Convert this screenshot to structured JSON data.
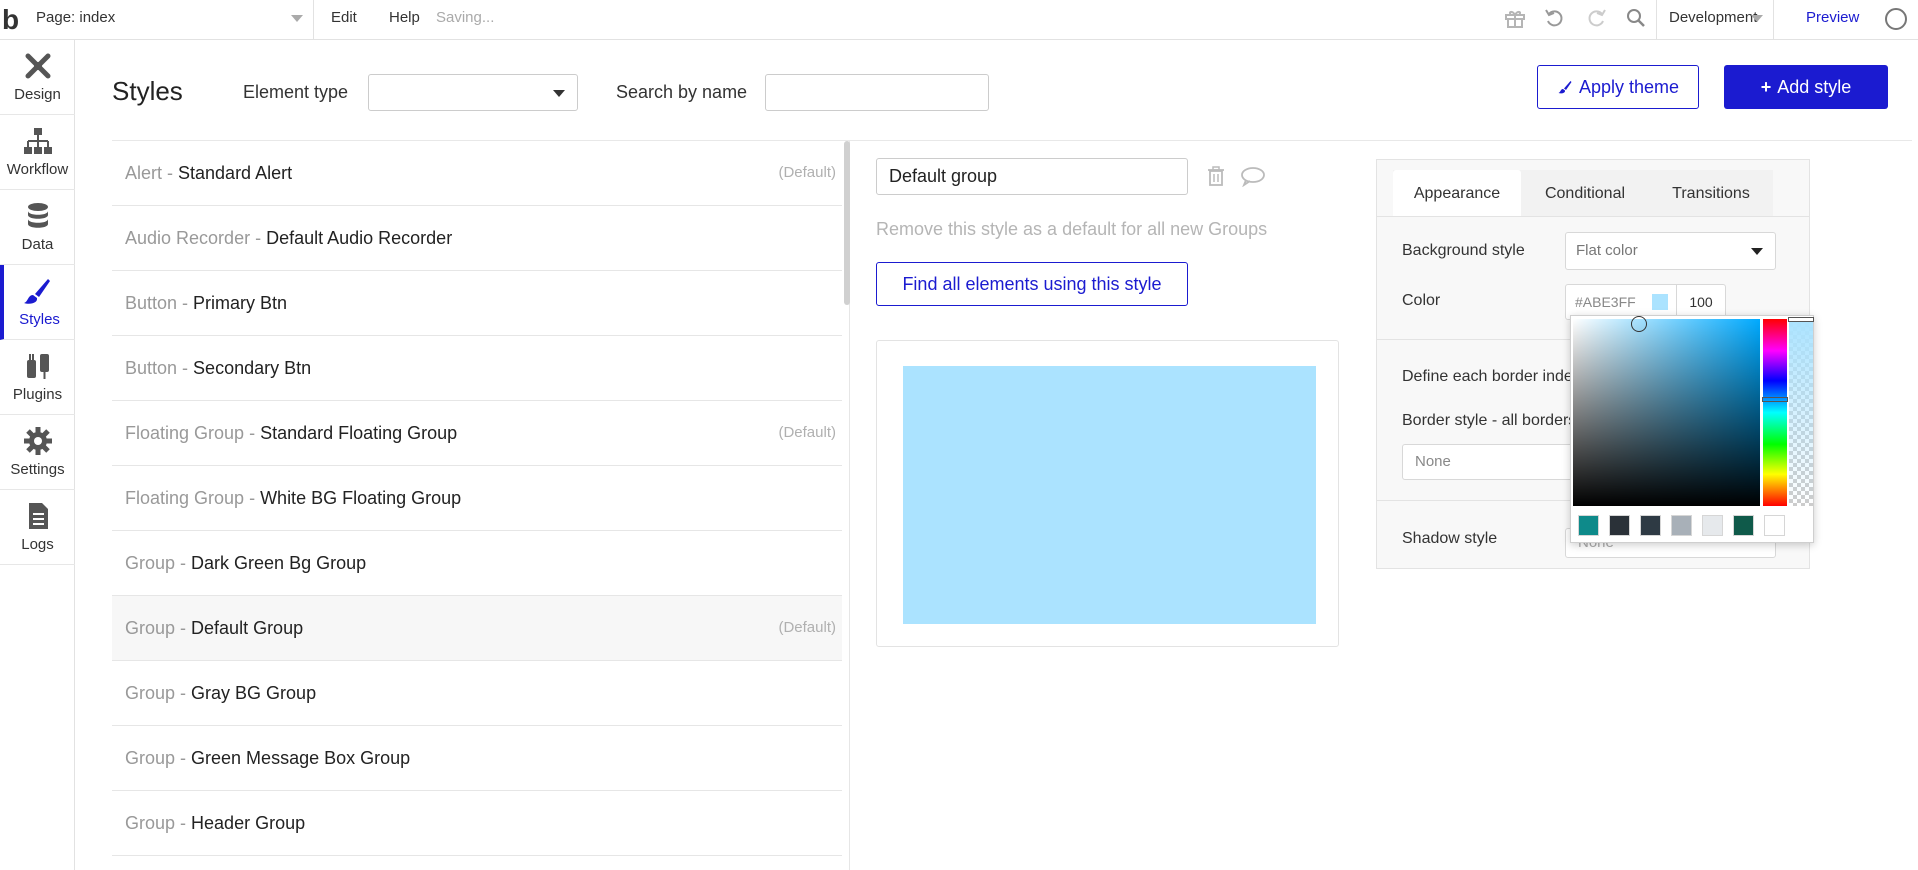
{
  "topbar": {
    "page_label": "Page: index",
    "menu": [
      "Edit",
      "Help"
    ],
    "status": "Saving...",
    "environment": "Development",
    "preview_label": "Preview"
  },
  "sidebar": {
    "items": [
      {
        "label": "Design",
        "icon": "design-icon"
      },
      {
        "label": "Workflow",
        "icon": "workflow-icon"
      },
      {
        "label": "Data",
        "icon": "data-icon"
      },
      {
        "label": "Styles",
        "icon": "styles-icon",
        "active": true
      },
      {
        "label": "Plugins",
        "icon": "plugins-icon"
      },
      {
        "label": "Settings",
        "icon": "settings-icon"
      },
      {
        "label": "Logs",
        "icon": "logs-icon"
      }
    ]
  },
  "header": {
    "title": "Styles",
    "element_type_label": "Element type",
    "element_type_value": "",
    "search_label": "Search by name",
    "search_value": "",
    "apply_theme_label": "Apply theme",
    "add_style_label": "Add style"
  },
  "styles": [
    {
      "type": "Alert - ",
      "name": "Standard Alert",
      "default": "(Default)"
    },
    {
      "type": "Audio Recorder - ",
      "name": "Default Audio Recorder",
      "default": ""
    },
    {
      "type": "Button - ",
      "name": "Primary Btn",
      "default": ""
    },
    {
      "type": "Button - ",
      "name": "Secondary Btn",
      "default": ""
    },
    {
      "type": "Floating Group - ",
      "name": "Standard Floating Group",
      "default": "(Default)"
    },
    {
      "type": "Floating Group - ",
      "name": "White BG Floating Group",
      "default": ""
    },
    {
      "type": "Group - ",
      "name": "Dark Green Bg Group",
      "default": ""
    },
    {
      "type": "Group - ",
      "name": "Default Group",
      "default": "(Default)",
      "selected": true
    },
    {
      "type": "Group - ",
      "name": "Gray BG Group",
      "default": ""
    },
    {
      "type": "Group - ",
      "name": "Green Message Box Group",
      "default": ""
    },
    {
      "type": "Group - ",
      "name": "Header Group",
      "default": ""
    }
  ],
  "editor": {
    "style_name": "Default group",
    "remove_default_text": "Remove this style as a default for all new Groups",
    "find_button_label": "Find all elements using this style",
    "preview_color": "#ABE3FF"
  },
  "properties": {
    "tabs": [
      "Appearance",
      "Conditional",
      "Transitions"
    ],
    "active_tab": "Appearance",
    "background_style_label": "Background style",
    "background_style_value": "Flat color",
    "color_label": "Color",
    "color_value": "#ABE3FF",
    "opacity_value": "100",
    "border_define_label": "Define each border inde",
    "border_style_label": "Border style - all borders",
    "border_style_value": "None",
    "shadow_style_label": "Shadow style",
    "shadow_style_value": "None"
  },
  "picker": {
    "hue_color": "#00AAFF",
    "presets": [
      "#0E8A8A",
      "#2A3138",
      "#2E3A44",
      "#A8B0B8",
      "#E6E9EC",
      "#0F5A4A",
      "#FFFFFF"
    ]
  },
  "colors": {
    "accent": "#1B1BD0",
    "preview_fill": "#ABE3FF"
  }
}
